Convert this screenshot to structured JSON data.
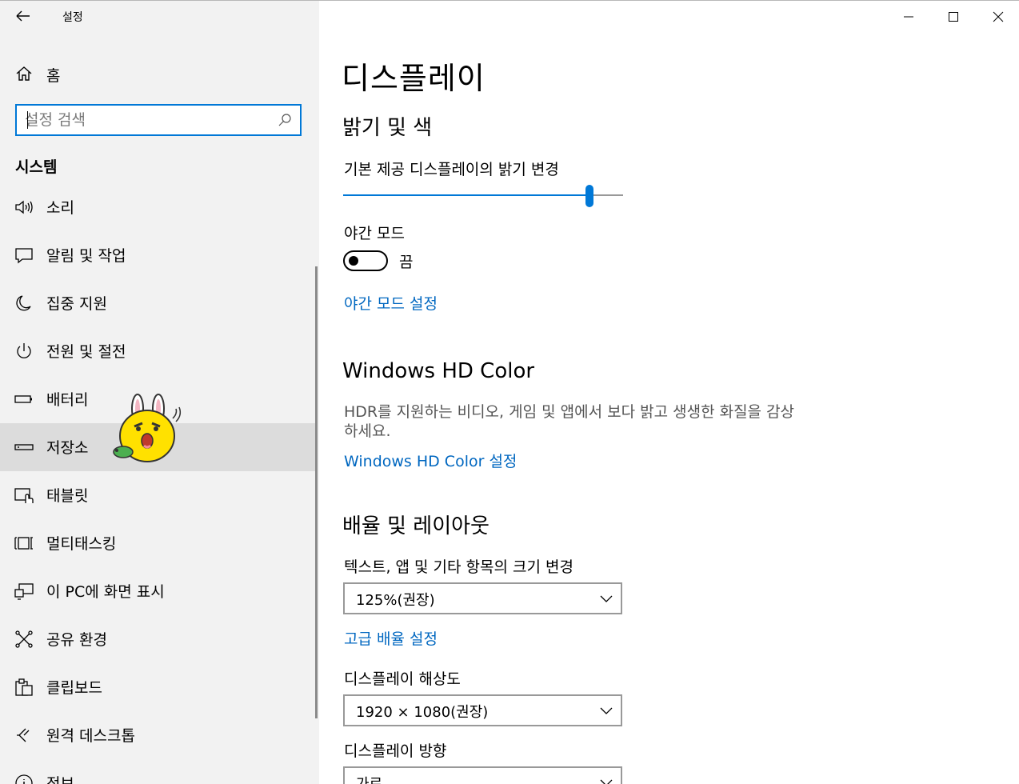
{
  "app": {
    "title": "설정"
  },
  "sidebar": {
    "home_label": "홈",
    "search_placeholder": "설정 검색",
    "section_title": "시스템",
    "items": [
      {
        "label": "소리",
        "icon": "speaker-icon"
      },
      {
        "label": "알림 및 작업",
        "icon": "notification-icon"
      },
      {
        "label": "집중 지원",
        "icon": "moon-icon"
      },
      {
        "label": "전원 및 절전",
        "icon": "power-icon"
      },
      {
        "label": "배터리",
        "icon": "battery-icon"
      },
      {
        "label": "저장소",
        "icon": "storage-icon",
        "selected": true
      },
      {
        "label": "태블릿",
        "icon": "tablet-icon"
      },
      {
        "label": "멀티태스킹",
        "icon": "multitasking-icon"
      },
      {
        "label": "이 PC에 화면 표시",
        "icon": "project-icon"
      },
      {
        "label": "공유 환경",
        "icon": "shared-experiences-icon"
      },
      {
        "label": "클립보드",
        "icon": "clipboard-icon"
      },
      {
        "label": "원격 데스크톱",
        "icon": "remote-desktop-icon"
      },
      {
        "label": "정보",
        "icon": "info-icon"
      }
    ]
  },
  "main": {
    "title": "디스플레이",
    "brightness": {
      "heading": "밝기 및 색",
      "label": "기본 제공 디스플레이의 밝기 변경",
      "value_percent": 88
    },
    "night_light": {
      "label": "야간 모드",
      "state": "끔",
      "settings_link": "야간 모드 설정"
    },
    "hd_color": {
      "heading": "Windows HD Color",
      "description": "HDR를 지원하는 비디오, 게임 및 앱에서 보다 밝고 생생한 화질을 감상하세요.",
      "link": "Windows HD Color 설정"
    },
    "scale_layout": {
      "heading": "배율 및 레이아웃",
      "scale_label": "텍스트, 앱 및 기타 항목의 크기 변경",
      "scale_value": "125%(권장)",
      "advanced_link": "고급 배율 설정",
      "resolution_label": "디스플레이 해상도",
      "resolution_value": "1920 × 1080(권장)",
      "orientation_label": "디스플레이 방향",
      "orientation_value": "가로"
    }
  },
  "colors": {
    "accent": "#0078d7",
    "link": "#0067c0",
    "sidebar_bg": "#f2f2f2",
    "selected_bg": "#dcdcdc"
  }
}
